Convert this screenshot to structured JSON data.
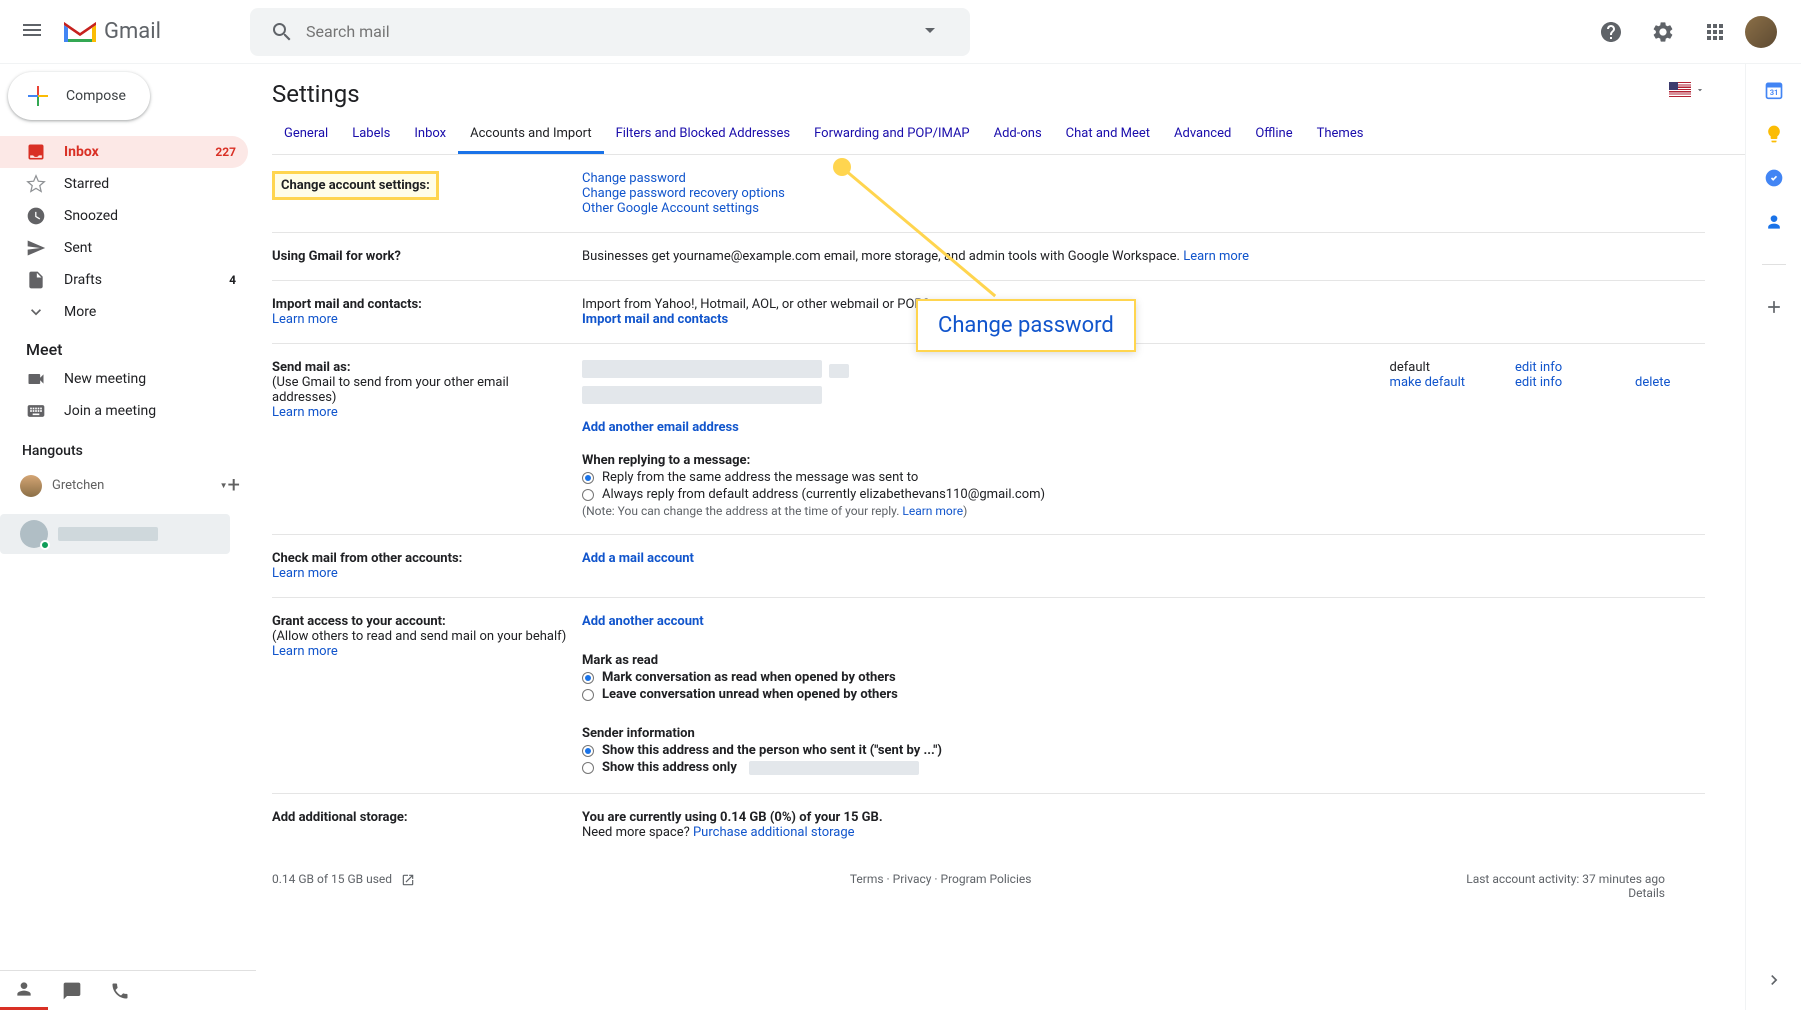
{
  "header": {
    "logo_text": "Gmail",
    "search_placeholder": "Search mail"
  },
  "compose_label": "Compose",
  "nav": {
    "inbox": "Inbox",
    "inbox_count": "227",
    "starred": "Starred",
    "snoozed": "Snoozed",
    "sent": "Sent",
    "drafts": "Drafts",
    "drafts_count": "4",
    "more": "More"
  },
  "meet": {
    "title": "Meet",
    "new": "New meeting",
    "join": "Join a meeting"
  },
  "hangouts": {
    "title": "Hangouts",
    "user": "Gretchen"
  },
  "settings": {
    "title": "Settings",
    "tabs": [
      "General",
      "Labels",
      "Inbox",
      "Accounts and Import",
      "Filters and Blocked Addresses",
      "Forwarding and POP/IMAP",
      "Add-ons",
      "Chat and Meet",
      "Advanced",
      "Offline",
      "Themes"
    ],
    "active_tab": 3
  },
  "rows": {
    "acct_settings": {
      "label": "Change account settings:",
      "l1": "Change password",
      "l2": "Change password recovery options",
      "l3": "Other Google Account settings"
    },
    "work": {
      "label": "Using Gmail for work?",
      "text": "Businesses get yourname@example.com email, more storage, and admin tools with Google Workspace. ",
      "learn": "Learn more"
    },
    "import": {
      "label": "Import mail and contacts:",
      "learn": "Learn more",
      "text": "Import from Yahoo!, Hotmail, AOL, or other webmail or POP3 accounts.",
      "link": "Import mail and contacts"
    },
    "send": {
      "label": "Send mail as:",
      "sub": "(Use Gmail to send from your other email addresses)",
      "learn": "Learn more",
      "add": "Add another email address",
      "reply_hdr": "When replying to a message:",
      "r1": "Reply from the same address the message was sent to",
      "r2": "Always reply from default address (currently elizabethevans110@gmail.com)",
      "note_pre": "(Note: You can change the address at the time of your reply. ",
      "note_learn": "Learn more",
      "note_post": ")",
      "default": "default",
      "make_default": "make default",
      "edit_info": "edit info",
      "delete": "delete"
    },
    "check": {
      "label": "Check mail from other accounts:",
      "learn": "Learn more",
      "link": "Add a mail account"
    },
    "grant": {
      "label": "Grant access to your account:",
      "sub": "(Allow others to read and send mail on your behalf)",
      "learn": "Learn more",
      "link": "Add another account",
      "mark_hdr": "Mark as read",
      "m1": "Mark conversation as read when opened by others",
      "m2": "Leave conversation unread when opened by others",
      "sender_hdr": "Sender information",
      "s1": "Show this address and the person who sent it (\"sent by ...\")",
      "s2": "Show this address only"
    },
    "storage": {
      "label": "Add additional storage:",
      "text1": "You are currently using 0.14 GB (0%) of your 15 GB.",
      "text2": "Need more space? ",
      "link": "Purchase additional storage"
    }
  },
  "callout": "Change password",
  "footer": {
    "storage": "0.14 GB of 15 GB used",
    "terms": "Terms",
    "privacy": "Privacy",
    "policies": "Program Policies",
    "activity": "Last account activity: 37 minutes ago",
    "details": "Details"
  }
}
